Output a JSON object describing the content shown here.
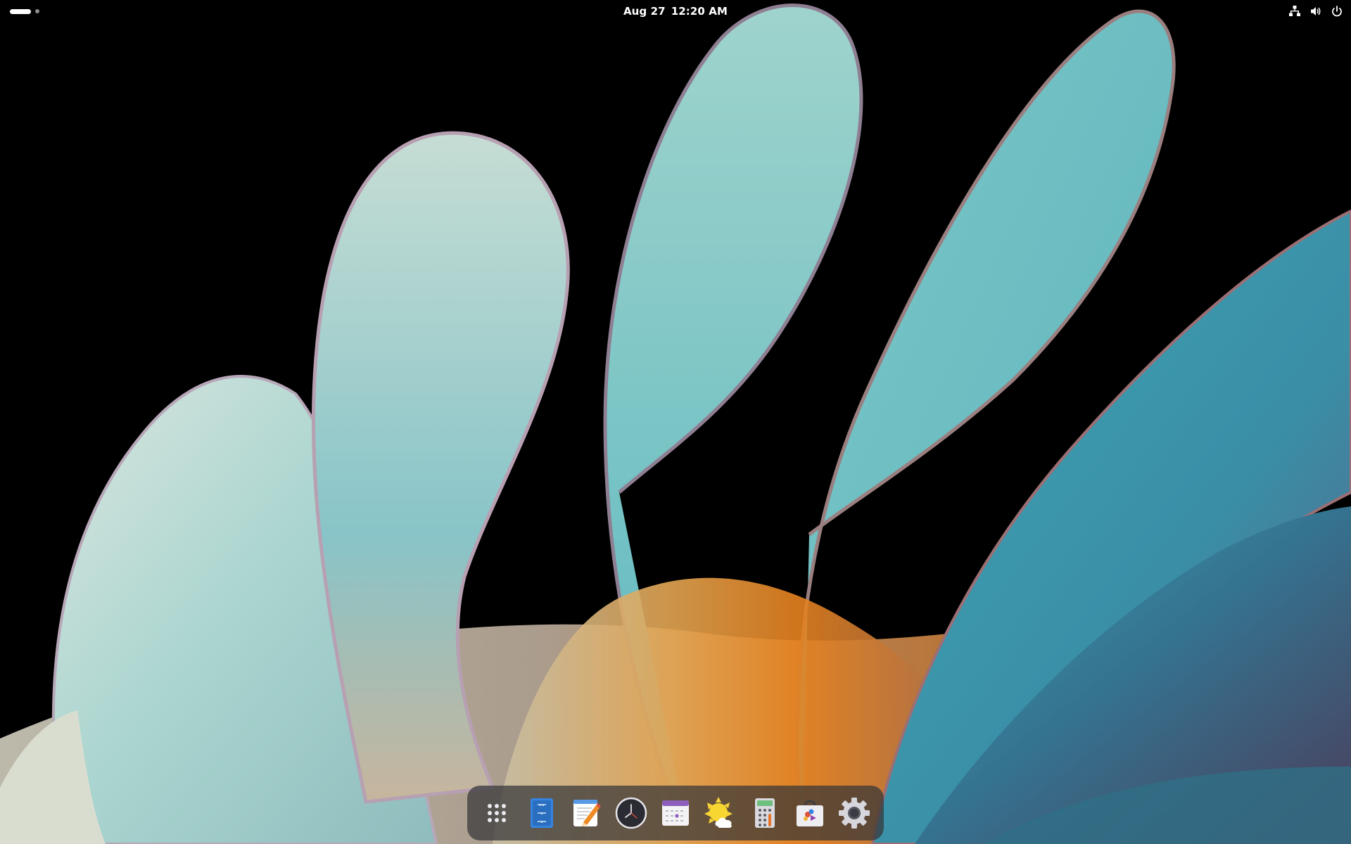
{
  "topbar": {
    "date": "Aug 27",
    "time": "12:20 AM",
    "icons": [
      "workspace-indicator",
      "network-icon",
      "volume-icon",
      "power-icon"
    ]
  },
  "dock": {
    "items": [
      {
        "name": "show-apps",
        "icon": "app-grid-icon"
      },
      {
        "name": "files",
        "icon": "files-icon"
      },
      {
        "name": "text-editor",
        "icon": "text-editor-icon"
      },
      {
        "name": "clocks",
        "icon": "clock-icon"
      },
      {
        "name": "calendar",
        "icon": "calendar-icon"
      },
      {
        "name": "weather",
        "icon": "weather-icon"
      },
      {
        "name": "calculator",
        "icon": "calculator-icon"
      },
      {
        "name": "software",
        "icon": "software-store-icon"
      },
      {
        "name": "settings",
        "icon": "settings-gear-icon"
      }
    ]
  },
  "colors": {
    "background": "#000000",
    "petal_teal": "#6cc3c6",
    "petal_light": "#c9ddd3",
    "petal_orange": "#e08a2a",
    "dock_bg": "#343438"
  }
}
